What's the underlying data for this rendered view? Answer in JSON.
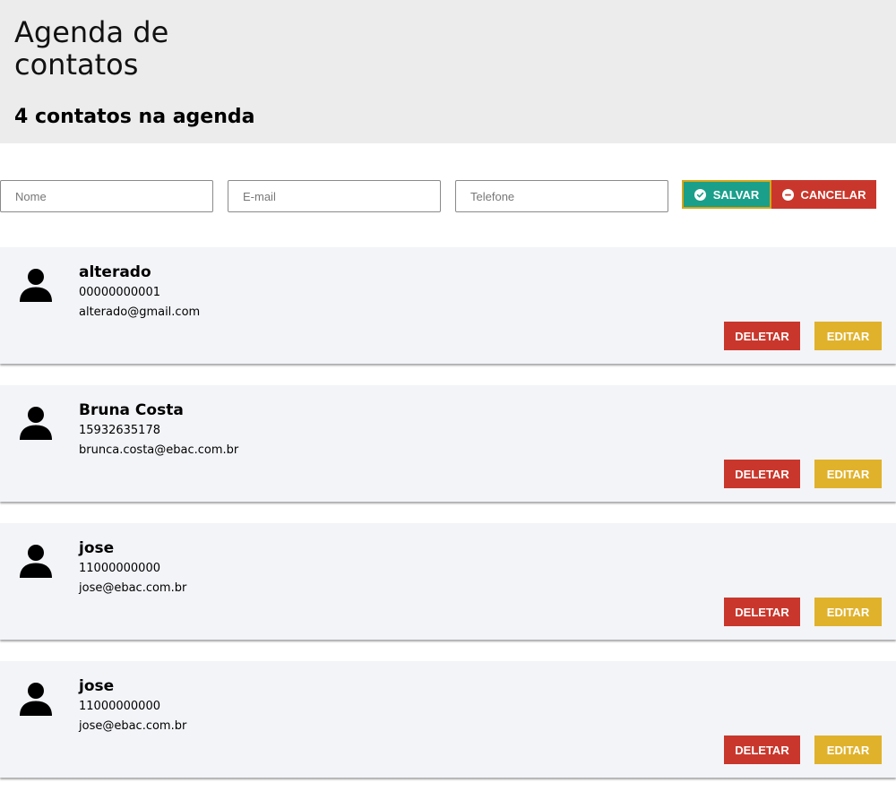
{
  "header": {
    "title": "Agenda de contatos",
    "count_text": "4 contatos na agenda"
  },
  "form": {
    "name_placeholder": "Nome",
    "email_placeholder": "E-mail",
    "phone_placeholder": "Telefone",
    "save_label": "SALVAR",
    "cancel_label": "CANCELAR"
  },
  "contacts": [
    {
      "name": "alterado",
      "phone": "00000000001",
      "email": "alterado@gmail.com",
      "delete_label": "DELETAR",
      "edit_label": "EDITAR"
    },
    {
      "name": "Bruna Costa",
      "phone": "15932635178",
      "email": "brunca.costa@ebac.com.br",
      "delete_label": "DELETAR",
      "edit_label": "EDITAR"
    },
    {
      "name": "jose",
      "phone": "11000000000",
      "email": "jose@ebac.com.br",
      "delete_label": "DELETAR",
      "edit_label": "EDITAR"
    },
    {
      "name": "jose",
      "phone": "11000000000",
      "email": "jose@ebac.com.br",
      "delete_label": "DELETAR",
      "edit_label": "EDITAR"
    }
  ],
  "colors": {
    "header_bg": "#ececec",
    "card_bg": "#f3f4f8",
    "save": "#1a9f8a",
    "danger": "#c9372c",
    "warning": "#e0b22c"
  },
  "icons": {
    "save": "check-circle-icon",
    "cancel": "minus-circle-icon",
    "avatar": "person-icon"
  }
}
